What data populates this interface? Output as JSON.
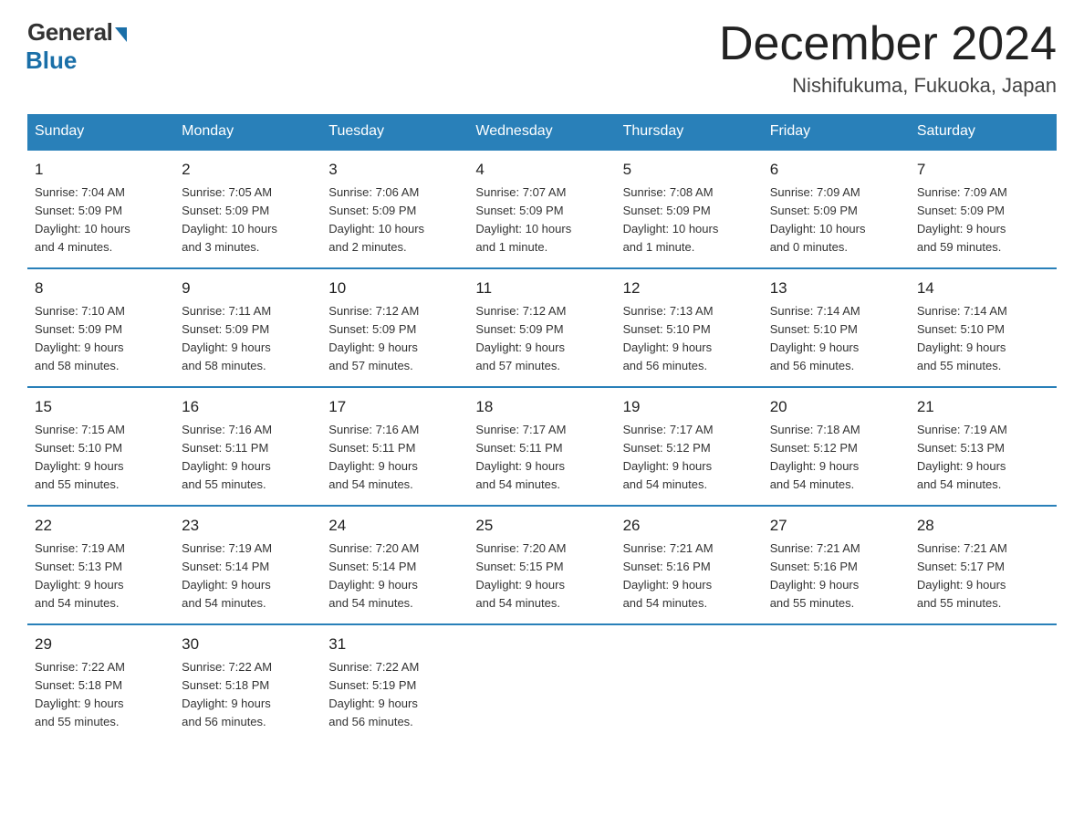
{
  "logo": {
    "general": "General",
    "blue": "Blue"
  },
  "title": "December 2024",
  "location": "Nishifukuma, Fukuoka, Japan",
  "days_of_week": [
    "Sunday",
    "Monday",
    "Tuesday",
    "Wednesday",
    "Thursday",
    "Friday",
    "Saturday"
  ],
  "weeks": [
    [
      {
        "day": "1",
        "info": "Sunrise: 7:04 AM\nSunset: 5:09 PM\nDaylight: 10 hours\nand 4 minutes."
      },
      {
        "day": "2",
        "info": "Sunrise: 7:05 AM\nSunset: 5:09 PM\nDaylight: 10 hours\nand 3 minutes."
      },
      {
        "day": "3",
        "info": "Sunrise: 7:06 AM\nSunset: 5:09 PM\nDaylight: 10 hours\nand 2 minutes."
      },
      {
        "day": "4",
        "info": "Sunrise: 7:07 AM\nSunset: 5:09 PM\nDaylight: 10 hours\nand 1 minute."
      },
      {
        "day": "5",
        "info": "Sunrise: 7:08 AM\nSunset: 5:09 PM\nDaylight: 10 hours\nand 1 minute."
      },
      {
        "day": "6",
        "info": "Sunrise: 7:09 AM\nSunset: 5:09 PM\nDaylight: 10 hours\nand 0 minutes."
      },
      {
        "day": "7",
        "info": "Sunrise: 7:09 AM\nSunset: 5:09 PM\nDaylight: 9 hours\nand 59 minutes."
      }
    ],
    [
      {
        "day": "8",
        "info": "Sunrise: 7:10 AM\nSunset: 5:09 PM\nDaylight: 9 hours\nand 58 minutes."
      },
      {
        "day": "9",
        "info": "Sunrise: 7:11 AM\nSunset: 5:09 PM\nDaylight: 9 hours\nand 58 minutes."
      },
      {
        "day": "10",
        "info": "Sunrise: 7:12 AM\nSunset: 5:09 PM\nDaylight: 9 hours\nand 57 minutes."
      },
      {
        "day": "11",
        "info": "Sunrise: 7:12 AM\nSunset: 5:09 PM\nDaylight: 9 hours\nand 57 minutes."
      },
      {
        "day": "12",
        "info": "Sunrise: 7:13 AM\nSunset: 5:10 PM\nDaylight: 9 hours\nand 56 minutes."
      },
      {
        "day": "13",
        "info": "Sunrise: 7:14 AM\nSunset: 5:10 PM\nDaylight: 9 hours\nand 56 minutes."
      },
      {
        "day": "14",
        "info": "Sunrise: 7:14 AM\nSunset: 5:10 PM\nDaylight: 9 hours\nand 55 minutes."
      }
    ],
    [
      {
        "day": "15",
        "info": "Sunrise: 7:15 AM\nSunset: 5:10 PM\nDaylight: 9 hours\nand 55 minutes."
      },
      {
        "day": "16",
        "info": "Sunrise: 7:16 AM\nSunset: 5:11 PM\nDaylight: 9 hours\nand 55 minutes."
      },
      {
        "day": "17",
        "info": "Sunrise: 7:16 AM\nSunset: 5:11 PM\nDaylight: 9 hours\nand 54 minutes."
      },
      {
        "day": "18",
        "info": "Sunrise: 7:17 AM\nSunset: 5:11 PM\nDaylight: 9 hours\nand 54 minutes."
      },
      {
        "day": "19",
        "info": "Sunrise: 7:17 AM\nSunset: 5:12 PM\nDaylight: 9 hours\nand 54 minutes."
      },
      {
        "day": "20",
        "info": "Sunrise: 7:18 AM\nSunset: 5:12 PM\nDaylight: 9 hours\nand 54 minutes."
      },
      {
        "day": "21",
        "info": "Sunrise: 7:19 AM\nSunset: 5:13 PM\nDaylight: 9 hours\nand 54 minutes."
      }
    ],
    [
      {
        "day": "22",
        "info": "Sunrise: 7:19 AM\nSunset: 5:13 PM\nDaylight: 9 hours\nand 54 minutes."
      },
      {
        "day": "23",
        "info": "Sunrise: 7:19 AM\nSunset: 5:14 PM\nDaylight: 9 hours\nand 54 minutes."
      },
      {
        "day": "24",
        "info": "Sunrise: 7:20 AM\nSunset: 5:14 PM\nDaylight: 9 hours\nand 54 minutes."
      },
      {
        "day": "25",
        "info": "Sunrise: 7:20 AM\nSunset: 5:15 PM\nDaylight: 9 hours\nand 54 minutes."
      },
      {
        "day": "26",
        "info": "Sunrise: 7:21 AM\nSunset: 5:16 PM\nDaylight: 9 hours\nand 54 minutes."
      },
      {
        "day": "27",
        "info": "Sunrise: 7:21 AM\nSunset: 5:16 PM\nDaylight: 9 hours\nand 55 minutes."
      },
      {
        "day": "28",
        "info": "Sunrise: 7:21 AM\nSunset: 5:17 PM\nDaylight: 9 hours\nand 55 minutes."
      }
    ],
    [
      {
        "day": "29",
        "info": "Sunrise: 7:22 AM\nSunset: 5:18 PM\nDaylight: 9 hours\nand 55 minutes."
      },
      {
        "day": "30",
        "info": "Sunrise: 7:22 AM\nSunset: 5:18 PM\nDaylight: 9 hours\nand 56 minutes."
      },
      {
        "day": "31",
        "info": "Sunrise: 7:22 AM\nSunset: 5:19 PM\nDaylight: 9 hours\nand 56 minutes."
      },
      null,
      null,
      null,
      null
    ]
  ]
}
